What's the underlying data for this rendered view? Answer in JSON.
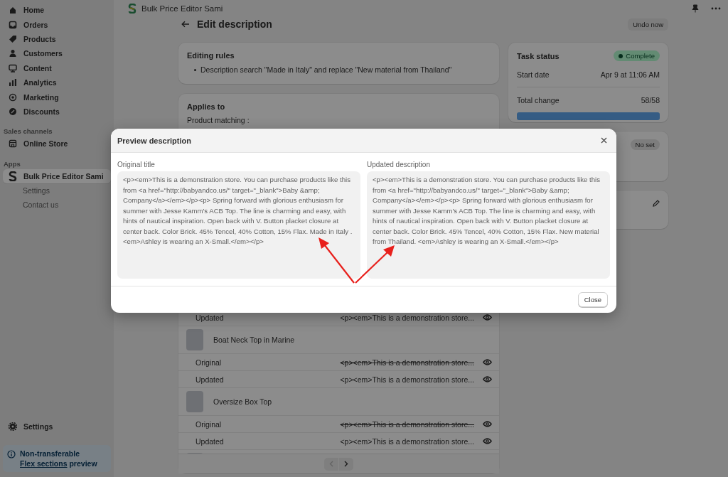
{
  "top_bar": {
    "app_name": "Bulk Price Editor Sami"
  },
  "sidebar": {
    "items": [
      {
        "label": "Home",
        "selected": false
      },
      {
        "label": "Orders",
        "selected": false
      },
      {
        "label": "Products",
        "selected": false
      },
      {
        "label": "Customers",
        "selected": false
      },
      {
        "label": "Content",
        "selected": false
      },
      {
        "label": "Analytics",
        "selected": false
      },
      {
        "label": "Marketing",
        "selected": false
      },
      {
        "label": "Discounts",
        "selected": false
      }
    ],
    "sales_channels": {
      "heading": "Sales channels",
      "items": [
        {
          "label": "Online Store",
          "selected": false
        }
      ]
    },
    "apps": {
      "heading": "Apps",
      "items": [
        {
          "label": "Bulk Price Editor Sami",
          "selected": true,
          "children": [
            {
              "label": "Settings",
              "selected": false
            },
            {
              "label": "Contact us",
              "selected": false
            }
          ]
        }
      ]
    },
    "footer_item": {
      "label": "Settings"
    },
    "notice": {
      "title": "Non-transferable",
      "link": "Flex sections",
      "rest": "preview"
    }
  },
  "page": {
    "title": "Edit description",
    "undo_button": "Undo now"
  },
  "editing_rules": {
    "title": "Editing rules",
    "rules": [
      "Description search \"Made in Italy\" and replace \"New material from Thailand\""
    ]
  },
  "applies_to": {
    "title": "Applies to",
    "label": "Product matching :",
    "rows": [
      {
        "kind": "version",
        "label": "Updated",
        "value": "<p><em>This is a demonstration store...",
        "struck": false
      },
      {
        "kind": "product",
        "name": "Boat Neck Top in Marine"
      },
      {
        "kind": "version",
        "label": "Original",
        "value": "<p><em>This is a demonstration store...",
        "struck": true
      },
      {
        "kind": "version",
        "label": "Updated",
        "value": "<p><em>This is a demonstration store...",
        "struck": false
      },
      {
        "kind": "product",
        "name": "Oversize Box Top"
      },
      {
        "kind": "version",
        "label": "Original",
        "value": "<p><em>This is a demonstration store...",
        "struck": true
      },
      {
        "kind": "version",
        "label": "Updated",
        "value": "<p><em>This is a demonstration store...",
        "struck": false
      },
      {
        "kind": "product"
      }
    ],
    "pagination": {
      "previous_disabled": true,
      "next_disabled": false
    }
  },
  "task_status": {
    "title": "Task status",
    "badge": "Complete",
    "start_label": "Start date",
    "start_value": "Apr 9 at 11:06 AM",
    "total_label": "Total change",
    "total_value": "58/58",
    "level": 1
  },
  "schedule_card": {
    "badge": "No set"
  },
  "modal": {
    "title": "Preview description",
    "original_label": "Original title",
    "original_text": "<p><em>This is a demonstration store. You can purchase products like this from <a href=\"http://babyandco.us/\" target=\"_blank\">Baby &amp; Company</a></em></p><p> Spring forward with glorious enthusiasm for summer with Jesse Kamm's ACB Top. The line is charming and easy, with hints of nautical inspiration. Open back with V. Button placket closure at center back. Color Brick. 45% Tencel, 40% Cotton, 15% Flax. Made in Italy . <em>Ashley is wearing an X-Small.</em></p>",
    "updated_label": "Updated description",
    "updated_text": "<p><em>This is a demonstration store. You can purchase products like this from <a href=\"http://babyandco.us/\" target=\"_blank\">Baby &amp; Company</a></em></p><p> Spring forward with glorious enthusiasm for summer with Jesse Kamm's ACB Top. The line is charming and easy, with hints of nautical inspiration. Open back with V. Button placket closure at center back. Color Brick. 45% Tencel, 40% Cotton, 15% Flax. New material from Thailand. <em>Ashley is wearing an X-Small.</em></p>",
    "close_button": "Close"
  }
}
